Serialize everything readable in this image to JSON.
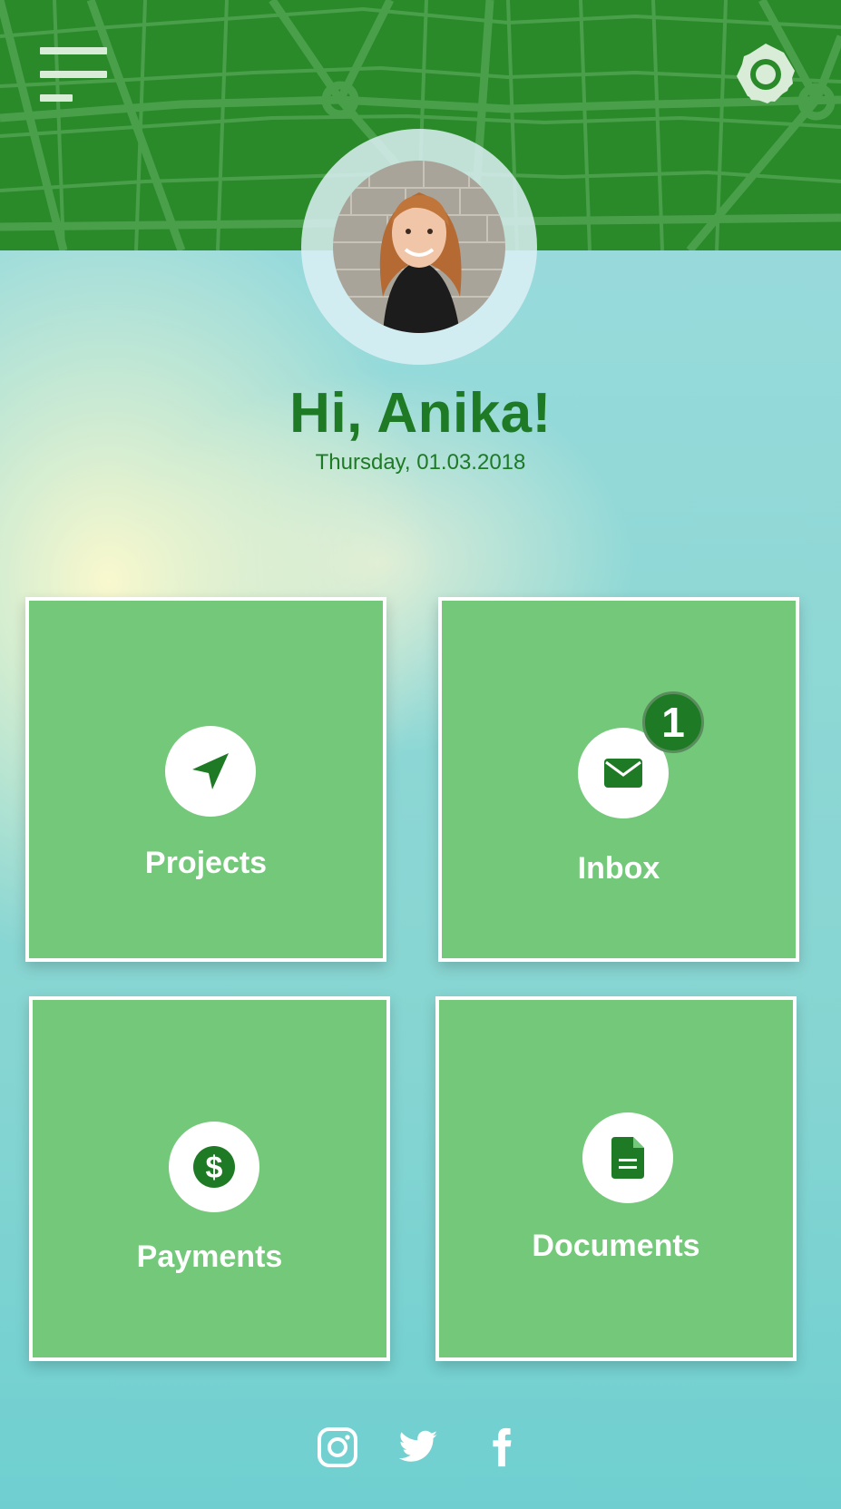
{
  "header": {
    "menu_icon": "hamburger-menu-icon",
    "settings_icon": "brightness-icon",
    "background_color": "#2a8a2a"
  },
  "profile": {
    "greeting": "Hi, Anika!",
    "date": "Thursday, 01.03.2018",
    "avatar_icon": "profile-photo"
  },
  "tiles": [
    {
      "label": "Projects",
      "icon": "navigation-arrow-icon"
    },
    {
      "label": "Inbox",
      "icon": "envelope-icon",
      "badge": "1"
    },
    {
      "label": "Payments",
      "icon": "dollar-icon"
    },
    {
      "label": "Documents",
      "icon": "document-icon"
    }
  ],
  "social": [
    {
      "icon": "instagram-icon"
    },
    {
      "icon": "twitter-icon"
    },
    {
      "icon": "facebook-icon"
    }
  ],
  "colors": {
    "accent": "#1e7a24",
    "tile": "#74c87a",
    "header": "#2a8a2a"
  }
}
